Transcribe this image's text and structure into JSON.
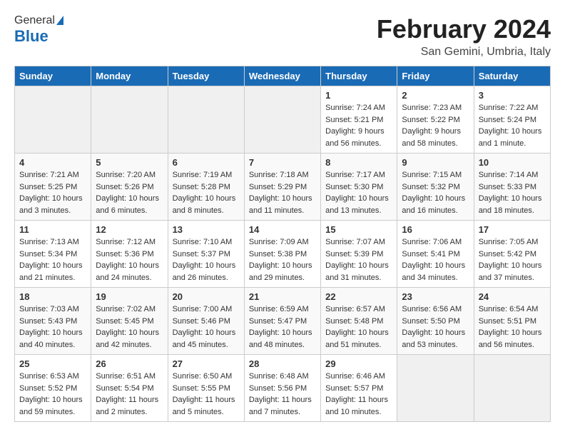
{
  "header": {
    "logo_line1": "General",
    "logo_line2": "Blue",
    "month_title": "February 2024",
    "location": "San Gemini, Umbria, Italy"
  },
  "days_of_week": [
    "Sunday",
    "Monday",
    "Tuesday",
    "Wednesday",
    "Thursday",
    "Friday",
    "Saturday"
  ],
  "weeks": [
    [
      {
        "day": "",
        "info": ""
      },
      {
        "day": "",
        "info": ""
      },
      {
        "day": "",
        "info": ""
      },
      {
        "day": "",
        "info": ""
      },
      {
        "day": "1",
        "info": "Sunrise: 7:24 AM\nSunset: 5:21 PM\nDaylight: 9 hours and 56 minutes."
      },
      {
        "day": "2",
        "info": "Sunrise: 7:23 AM\nSunset: 5:22 PM\nDaylight: 9 hours and 58 minutes."
      },
      {
        "day": "3",
        "info": "Sunrise: 7:22 AM\nSunset: 5:24 PM\nDaylight: 10 hours and 1 minute."
      }
    ],
    [
      {
        "day": "4",
        "info": "Sunrise: 7:21 AM\nSunset: 5:25 PM\nDaylight: 10 hours and 3 minutes."
      },
      {
        "day": "5",
        "info": "Sunrise: 7:20 AM\nSunset: 5:26 PM\nDaylight: 10 hours and 6 minutes."
      },
      {
        "day": "6",
        "info": "Sunrise: 7:19 AM\nSunset: 5:28 PM\nDaylight: 10 hours and 8 minutes."
      },
      {
        "day": "7",
        "info": "Sunrise: 7:18 AM\nSunset: 5:29 PM\nDaylight: 10 hours and 11 minutes."
      },
      {
        "day": "8",
        "info": "Sunrise: 7:17 AM\nSunset: 5:30 PM\nDaylight: 10 hours and 13 minutes."
      },
      {
        "day": "9",
        "info": "Sunrise: 7:15 AM\nSunset: 5:32 PM\nDaylight: 10 hours and 16 minutes."
      },
      {
        "day": "10",
        "info": "Sunrise: 7:14 AM\nSunset: 5:33 PM\nDaylight: 10 hours and 18 minutes."
      }
    ],
    [
      {
        "day": "11",
        "info": "Sunrise: 7:13 AM\nSunset: 5:34 PM\nDaylight: 10 hours and 21 minutes."
      },
      {
        "day": "12",
        "info": "Sunrise: 7:12 AM\nSunset: 5:36 PM\nDaylight: 10 hours and 24 minutes."
      },
      {
        "day": "13",
        "info": "Sunrise: 7:10 AM\nSunset: 5:37 PM\nDaylight: 10 hours and 26 minutes."
      },
      {
        "day": "14",
        "info": "Sunrise: 7:09 AM\nSunset: 5:38 PM\nDaylight: 10 hours and 29 minutes."
      },
      {
        "day": "15",
        "info": "Sunrise: 7:07 AM\nSunset: 5:39 PM\nDaylight: 10 hours and 31 minutes."
      },
      {
        "day": "16",
        "info": "Sunrise: 7:06 AM\nSunset: 5:41 PM\nDaylight: 10 hours and 34 minutes."
      },
      {
        "day": "17",
        "info": "Sunrise: 7:05 AM\nSunset: 5:42 PM\nDaylight: 10 hours and 37 minutes."
      }
    ],
    [
      {
        "day": "18",
        "info": "Sunrise: 7:03 AM\nSunset: 5:43 PM\nDaylight: 10 hours and 40 minutes."
      },
      {
        "day": "19",
        "info": "Sunrise: 7:02 AM\nSunset: 5:45 PM\nDaylight: 10 hours and 42 minutes."
      },
      {
        "day": "20",
        "info": "Sunrise: 7:00 AM\nSunset: 5:46 PM\nDaylight: 10 hours and 45 minutes."
      },
      {
        "day": "21",
        "info": "Sunrise: 6:59 AM\nSunset: 5:47 PM\nDaylight: 10 hours and 48 minutes."
      },
      {
        "day": "22",
        "info": "Sunrise: 6:57 AM\nSunset: 5:48 PM\nDaylight: 10 hours and 51 minutes."
      },
      {
        "day": "23",
        "info": "Sunrise: 6:56 AM\nSunset: 5:50 PM\nDaylight: 10 hours and 53 minutes."
      },
      {
        "day": "24",
        "info": "Sunrise: 6:54 AM\nSunset: 5:51 PM\nDaylight: 10 hours and 56 minutes."
      }
    ],
    [
      {
        "day": "25",
        "info": "Sunrise: 6:53 AM\nSunset: 5:52 PM\nDaylight: 10 hours and 59 minutes."
      },
      {
        "day": "26",
        "info": "Sunrise: 6:51 AM\nSunset: 5:54 PM\nDaylight: 11 hours and 2 minutes."
      },
      {
        "day": "27",
        "info": "Sunrise: 6:50 AM\nSunset: 5:55 PM\nDaylight: 11 hours and 5 minutes."
      },
      {
        "day": "28",
        "info": "Sunrise: 6:48 AM\nSunset: 5:56 PM\nDaylight: 11 hours and 7 minutes."
      },
      {
        "day": "29",
        "info": "Sunrise: 6:46 AM\nSunset: 5:57 PM\nDaylight: 11 hours and 10 minutes."
      },
      {
        "day": "",
        "info": ""
      },
      {
        "day": "",
        "info": ""
      }
    ]
  ]
}
